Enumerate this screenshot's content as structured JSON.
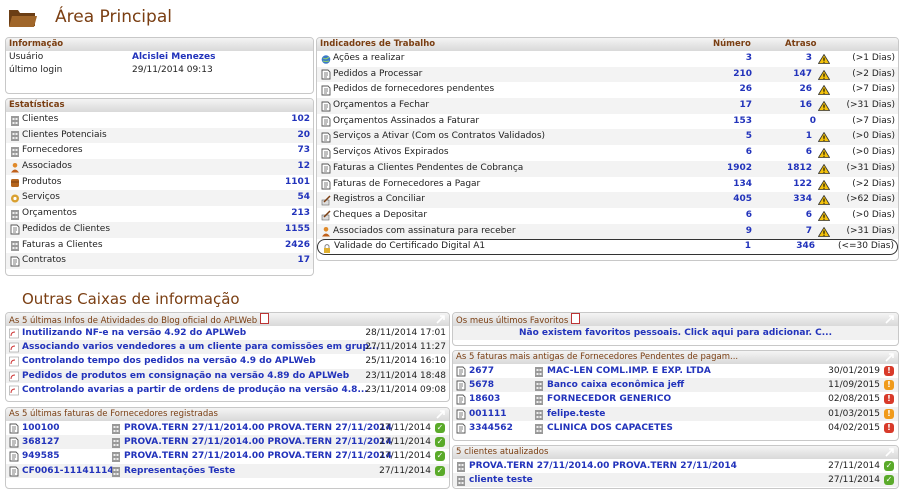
{
  "page_title": "Área Principal",
  "section2_title": "Outras Caixas de informação",
  "info": {
    "header": "Informação",
    "rows": [
      {
        "label": "Usuário",
        "value": "Alcislei Menezes"
      },
      {
        "label": "último login",
        "value": "29/11/2014 09:13"
      }
    ]
  },
  "stats": {
    "header": "Estatísticas",
    "rows": [
      {
        "label": "Clientes",
        "value": "102",
        "icon": "building-icon"
      },
      {
        "label": "Clientes Potenciais",
        "value": "20",
        "icon": "building-icon"
      },
      {
        "label": "Fornecedores",
        "value": "73",
        "icon": "building-icon"
      },
      {
        "label": "Associados",
        "value": "12",
        "icon": "person-icon"
      },
      {
        "label": "Produtos",
        "value": "1101",
        "icon": "box-icon"
      },
      {
        "label": "Serviços",
        "value": "54",
        "icon": "service-icon"
      },
      {
        "label": "Orçamentos",
        "value": "213",
        "icon": "building-icon"
      },
      {
        "label": "Pedidos de Clientes",
        "value": "1155",
        "icon": "document-icon"
      },
      {
        "label": "Faturas a Clientes",
        "value": "2426",
        "icon": "building-icon"
      },
      {
        "label": "Contratos",
        "value": "17",
        "icon": "document-icon"
      }
    ]
  },
  "indicators": {
    "header": "Indicadores de Trabalho",
    "col_number": "Número",
    "col_delay": "Atraso",
    "rows": [
      {
        "label": "Ações a realizar",
        "number": "3",
        "delay": "3",
        "warn": true,
        "limit": "(>1 Dias)",
        "icon": "globe-icon"
      },
      {
        "label": "Pedidos a Processar",
        "number": "210",
        "delay": "147",
        "warn": true,
        "limit": "(>2 Dias)",
        "icon": "document-icon"
      },
      {
        "label": "Pedidos de fornecedores pendentes",
        "number": "26",
        "delay": "26",
        "warn": true,
        "limit": "(>7 Dias)",
        "icon": "document-icon"
      },
      {
        "label": "Orçamentos a Fechar",
        "number": "17",
        "delay": "16",
        "warn": true,
        "limit": "(>31 Dias)",
        "icon": "document-icon"
      },
      {
        "label": "Orçamentos Assinados a Faturar",
        "number": "153",
        "delay": "0",
        "warn": false,
        "limit": "(>7 Dias)",
        "icon": "document-icon"
      },
      {
        "label": "Serviços a Ativar (Com os Contratos Validados)",
        "number": "5",
        "delay": "1",
        "warn": true,
        "limit": "(>0 Dias)",
        "icon": "document-icon"
      },
      {
        "label": "Serviços Ativos Expirados",
        "number": "6",
        "delay": "6",
        "warn": true,
        "limit": "(>0 Dias)",
        "icon": "document-icon"
      },
      {
        "label": "Faturas a Clientes Pendentes de Cobrança",
        "number": "1902",
        "delay": "1812",
        "warn": true,
        "limit": "(>31 Dias)",
        "icon": "document-icon"
      },
      {
        "label": "Faturas de Fornecedores a Pagar",
        "number": "134",
        "delay": "122",
        "warn": true,
        "limit": "(>2 Dias)",
        "icon": "document-icon"
      },
      {
        "label": "Registros a Conciliar",
        "number": "405",
        "delay": "334",
        "warn": true,
        "limit": "(>62 Dias)",
        "icon": "pen-icon"
      },
      {
        "label": "Cheques a Depositar",
        "number": "6",
        "delay": "6",
        "warn": true,
        "limit": "(>0 Dias)",
        "icon": "pen-icon"
      },
      {
        "label": "Associados com assinatura para receber",
        "number": "9",
        "delay": "7",
        "warn": true,
        "limit": "(>31 Dias)",
        "icon": "person-icon"
      },
      {
        "label": "Validade do Certificado Digital A1",
        "number": "1",
        "delay": "346",
        "warn": false,
        "limit": "(<=30 Dias)",
        "icon": "lock-icon"
      }
    ]
  },
  "blog": {
    "header": "As 5 últimas Infos de Atividades do Blog oficial do APLWeb",
    "rows": [
      {
        "title": "Inutilizando NF-e na versão 4.92 do APLWeb",
        "date": "28/11/2014 17:01"
      },
      {
        "title": "Associando varios vendedores a um cliente para comissões em grup...",
        "date": "27/11/2014 11:27"
      },
      {
        "title": "Controlando tempo dos pedidos na versão 4.9 do APLWeb",
        "date": "25/11/2014 16:10"
      },
      {
        "title": "Pedidos de produtos em consignação na versão 4.89 do APLWeb",
        "date": "23/11/2014 18:48"
      },
      {
        "title": "Controlando avarias a partir de ordens de produção na versão 4.8...",
        "date": "23/11/2014 09:08"
      }
    ]
  },
  "supplier_invoices": {
    "header": "As 5 últimas faturas de Fornecedores registradas",
    "rows": [
      {
        "ref": "100100",
        "supplier": "PROVA.TERN 27/11/2014.00 PROVA.TERN 27/11/2014",
        "date": "27/11/2014"
      },
      {
        "ref": "368127",
        "supplier": "PROVA.TERN 27/11/2014.00 PROVA.TERN 27/11/2014",
        "date": "27/11/2014"
      },
      {
        "ref": "949585",
        "supplier": "PROVA.TERN 27/11/2014.00 PROVA.TERN 27/11/2014",
        "date": "27/11/2014"
      },
      {
        "ref": "CF0061-11141114",
        "supplier": "Representações Teste",
        "date": "27/11/2014"
      }
    ]
  },
  "favorites": {
    "header": "Os meus últimos Favoritos",
    "message": "Não existem favoritos pessoais. Click aqui para adicionar. C..."
  },
  "pending_supplier": {
    "header": "As 5 faturas mais antigas de Fornecedores Pendentes de pagam...",
    "rows": [
      {
        "ref": "2677",
        "supplier": "MAC-LEN COML.IMP. E EXP. LTDA",
        "date": "30/01/2019",
        "status": "r"
      },
      {
        "ref": "5678",
        "supplier": "Banco caixa econômica jeff",
        "date": "11/09/2015",
        "status": "o"
      },
      {
        "ref": "18603",
        "supplier": "FORNECEDOR GENERICO",
        "date": "02/08/2015",
        "status": "r"
      },
      {
        "ref": "001111",
        "supplier": "felipe.teste",
        "date": "01/03/2015",
        "status": "o"
      },
      {
        "ref": "3344562",
        "supplier": "CLINICA DOS CAPACETES",
        "date": "04/02/2015",
        "status": "r"
      }
    ]
  },
  "clients_updated": {
    "header": "5 clientes atualizados",
    "rows": [
      {
        "name": "PROVA.TERN 27/11/2014.00 PROVA.TERN 27/11/2014",
        "date": "27/11/2014"
      },
      {
        "name": "cliente teste",
        "date": "27/11/2014"
      }
    ]
  },
  "colors": {
    "title": "#7a3e12",
    "link": "#2233bb",
    "ok": "#5aaa2a",
    "late": "#d83a2a",
    "warning": "#f09a1a"
  }
}
